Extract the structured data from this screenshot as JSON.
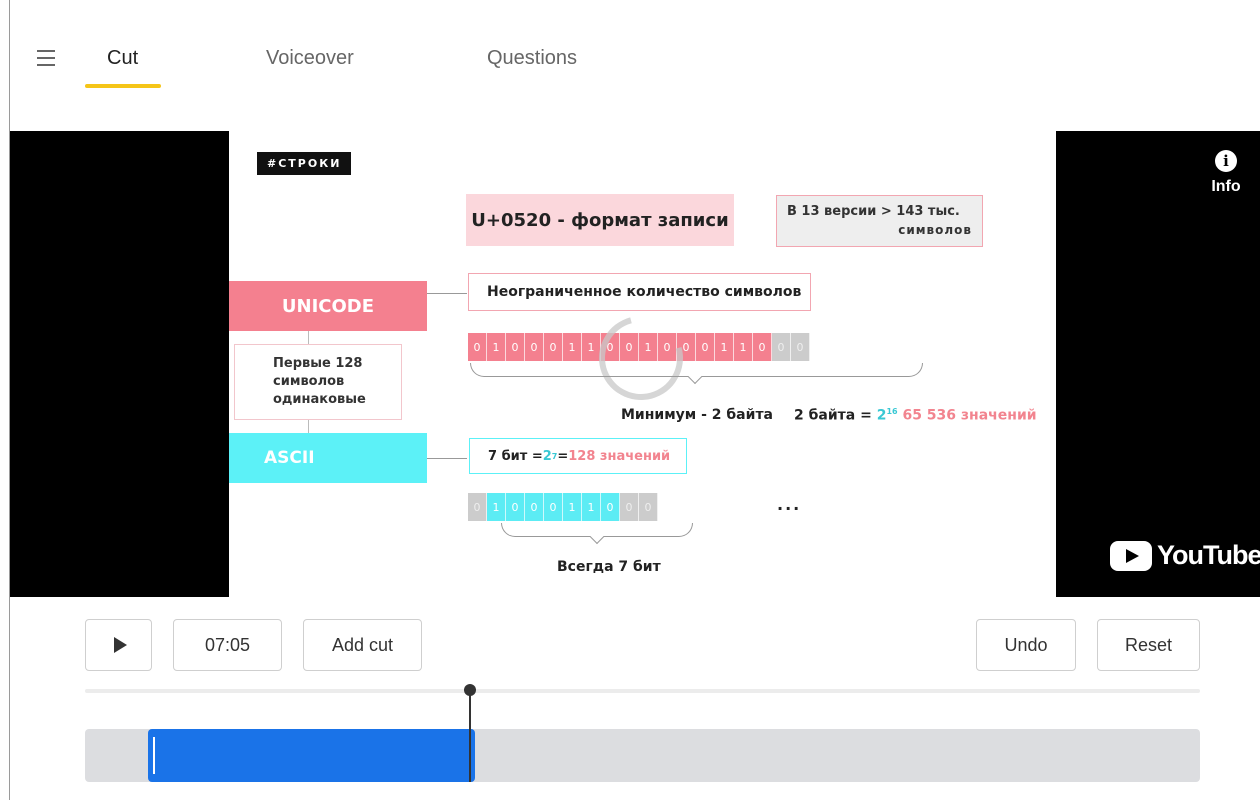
{
  "header": {
    "tabs": [
      {
        "label": "Cut",
        "active": true
      },
      {
        "label": "Voiceover",
        "active": false
      },
      {
        "label": "Questions",
        "active": false
      }
    ],
    "accent_color": "#f5c518"
  },
  "video": {
    "slide": {
      "hashtag": "#СТРОКИ",
      "format_note": "U+0520 - формат записи",
      "version_note_line1": "В 13 версии > 143 тыс.",
      "version_note_line2": "символов",
      "unicode_label": "UNICODE",
      "unlimited_note": "Неограниченное количество символов",
      "unicode_bits": [
        "0",
        "1",
        "0",
        "0",
        "0",
        "1",
        "1",
        "0",
        "0",
        "1",
        "0",
        "0",
        "0",
        "1",
        "1",
        "0",
        "0",
        "0"
      ],
      "first128_lines": [
        "Первые 128",
        "символов",
        "одинаковые"
      ],
      "min_bytes_label": "Минимум - 2 байта",
      "two_bytes_prefix": "2 байта = ",
      "two_pow": "2",
      "two_exp": "16",
      "two_bytes_values": "65 536 значений",
      "ascii_label": "ASCII",
      "seven_bit_prefix": "7 бит = ",
      "seven_pow": "2",
      "seven_exp": "7",
      "seven_eq": " = ",
      "seven_values": "128 значений",
      "ascii_bits": [
        "0",
        "1",
        "0",
        "0",
        "0",
        "1",
        "1",
        "0",
        "0",
        "0"
      ],
      "ellipsis": "...",
      "always_label": "Всегда 7 бит"
    },
    "info_label": "Info",
    "youtube_label": "YouTube"
  },
  "controls": {
    "time": "07:05",
    "add_cut_label": "Add cut",
    "undo_label": "Undo",
    "reset_label": "Reset"
  },
  "colors": {
    "pink": "#f4808f",
    "cyan": "#5cf1f7",
    "cut_blue": "#1a73e8"
  },
  "icons": [
    "hamburger-menu-icon",
    "info-icon",
    "play-icon",
    "youtube-logo-icon"
  ]
}
